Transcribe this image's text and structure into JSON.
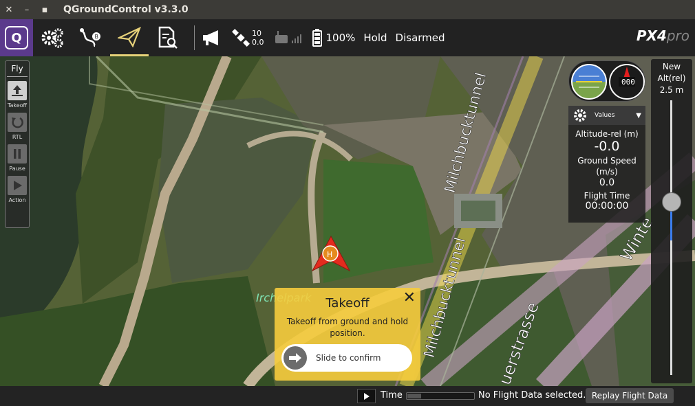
{
  "window": {
    "title": "QGroundControl v3.3.0",
    "close": "✕",
    "minimize": "–",
    "maximize": "▪"
  },
  "toolbar": {
    "gps_count": "10",
    "gps_hdop": "0.0",
    "battery": "100%",
    "flight_mode": "Hold",
    "arm_state": "Disarmed",
    "brand": "PX4",
    "brand_sub": "pro"
  },
  "fly_panel": {
    "title": "Fly",
    "buttons": [
      {
        "label": "Takeoff",
        "icon": "takeoff-icon",
        "active": true
      },
      {
        "label": "RTL",
        "icon": "rtl-icon",
        "active": false
      },
      {
        "label": "Pause",
        "icon": "pause-icon",
        "active": false
      },
      {
        "label": "Action",
        "icon": "play-icon",
        "active": false
      }
    ]
  },
  "map": {
    "labels": [
      "Milchbucktunnel",
      "Milchbucktunnel",
      "Irchelpark",
      "Winte",
      "uerstrasse"
    ],
    "home_marker": "H"
  },
  "values_widget": {
    "header": "Values",
    "items": [
      {
        "label": "Altitude-rel (m)",
        "value": "-0.0"
      },
      {
        "label": "Ground Speed (m/s)",
        "value": "0.0"
      },
      {
        "label": "Flight Time",
        "value": "00:00:00"
      }
    ]
  },
  "compass": {
    "heading": "000"
  },
  "altitude_slider": {
    "line1": "New",
    "line2": "Alt(rel)",
    "value": "2.5 m",
    "level": 0.38
  },
  "takeoff_dialog": {
    "title": "Takeoff",
    "message": "Takeoff from ground and hold position.",
    "slider_text": "Slide to confirm",
    "close": "✕"
  },
  "bottom_bar": {
    "time_label": "Time",
    "status": "No Flight Data selected..",
    "replay_button": "Replay Flight Data"
  },
  "colors": {
    "accent": "#f6cc3d",
    "brand": "#5b3a8c",
    "slider_fill": "#3b7ded"
  }
}
